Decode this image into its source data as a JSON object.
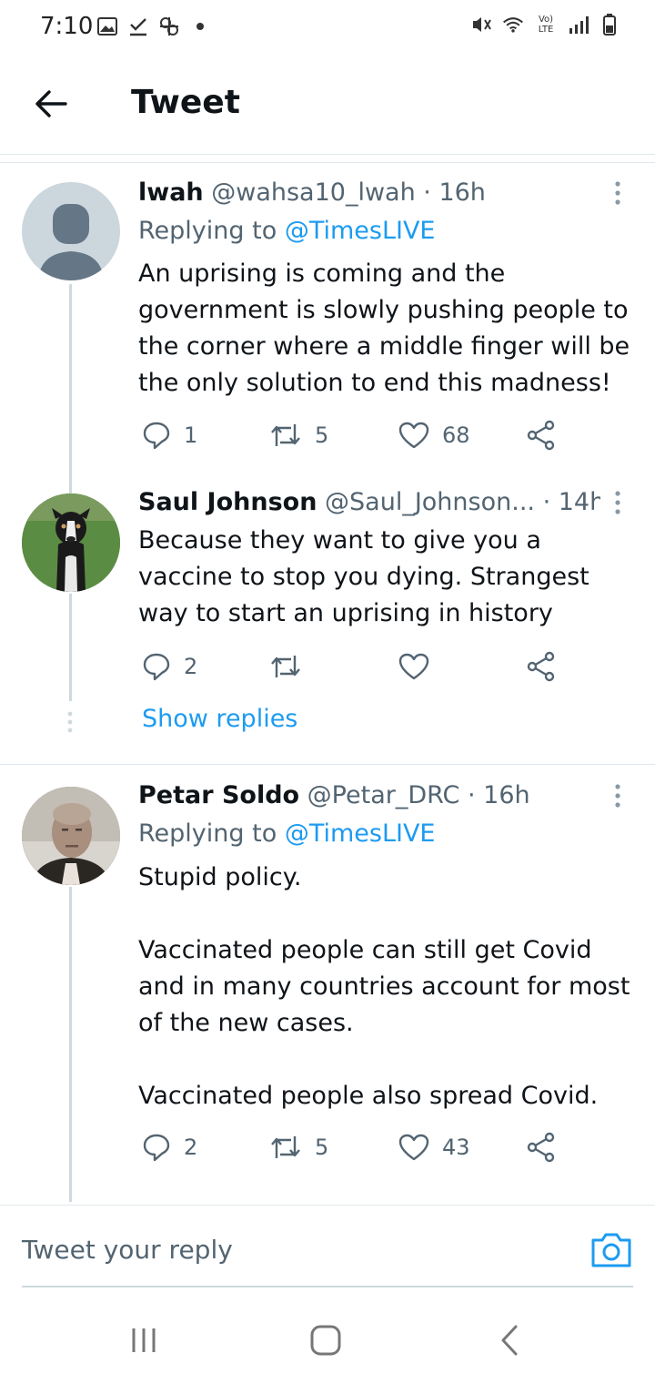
{
  "status_bar": {
    "time": "7:10",
    "left_icons": [
      "image-icon",
      "check-download-icon",
      "pinwheel-icon",
      "dot-icon"
    ],
    "right_icons": [
      "mute-icon",
      "wifi-icon",
      "volte-icon",
      "signal-icon",
      "battery-icon"
    ],
    "volte_text": "Vo) LTE"
  },
  "header": {
    "title": "Tweet"
  },
  "tweets": [
    {
      "name": "lwah",
      "handle": "@wahsa10_lwah",
      "time": "· 16h",
      "replying_prefix": "Replying to ",
      "replying_to": "@TimesLIVE",
      "body": "An uprising is coming and the government is slowly pushing people to the corner where a middle finger will be the only solution to end this madness!",
      "replies": "1",
      "retweets": "5",
      "likes": "68"
    },
    {
      "name": "Saul Johnson",
      "handle": "@Saul_Johnson...",
      "time": "· 14h",
      "body": "Because they want to give you a vaccine to stop you dying.  Strangest way to start an uprising in history",
      "replies": "2",
      "retweets": "",
      "likes": ""
    },
    {
      "name": "Petar Soldo",
      "handle": "@Petar_DRC",
      "time": "· 16h",
      "replying_prefix": "Replying to ",
      "replying_to": "@TimesLIVE",
      "body": "Stupid policy.\n\nVaccinated people can still get Covid and in many countries account for most of the new cases.\n\nVaccinated people also spread Covid.",
      "replies": "2",
      "retweets": "5",
      "likes": "43"
    }
  ],
  "show_replies": "Show replies",
  "reply_bar": {
    "placeholder": "Tweet your reply"
  },
  "colors": {
    "accent": "#1d9bf0",
    "text": "#0f1419",
    "muted": "#536471",
    "border": "#e1e8ed"
  }
}
